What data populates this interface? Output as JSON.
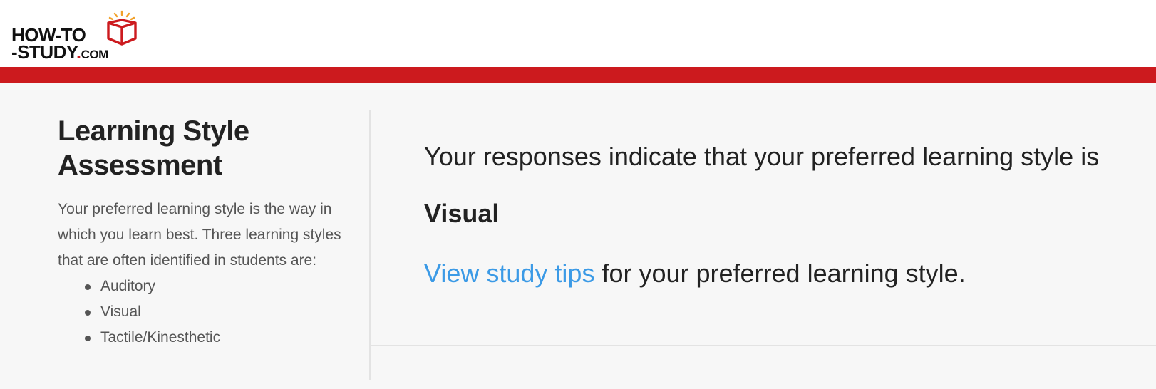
{
  "header": {
    "logo": {
      "line1": "HOW-TO",
      "line2_prefix": "-STUDY",
      "line2_dot": ".",
      "line2_suffix": "COM"
    }
  },
  "sidebar": {
    "title": "Learning Style Assessment",
    "description": "Your preferred learning style is the way in which you learn best. Three learning styles that are often identified in students are:",
    "styles": [
      "Auditory",
      "Visual",
      "Tactile/Kinesthetic"
    ]
  },
  "main": {
    "result_intro": "Your responses indicate that your preferred learning style is",
    "result_style": "Visual",
    "tips_link_label": "View study tips",
    "tips_suffix": " for your preferred learning style."
  },
  "colors": {
    "brand_red": "#cc1a1e",
    "link_blue": "#3b9ae6",
    "background": "#f7f7f7"
  }
}
